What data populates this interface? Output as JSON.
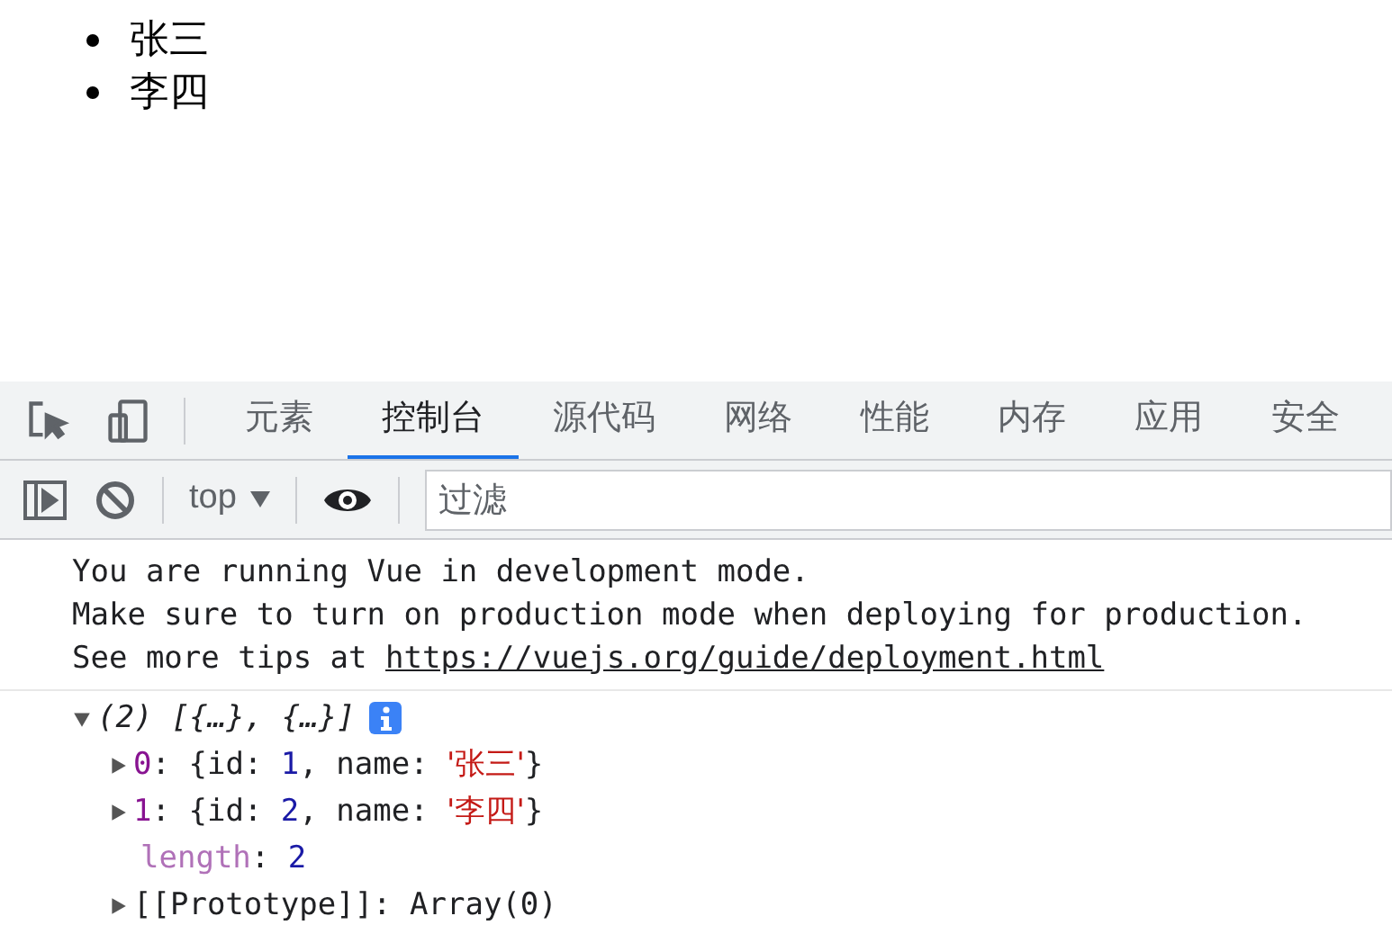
{
  "page_list": [
    "张三",
    "李四"
  ],
  "devtools": {
    "tabs": [
      {
        "label": "元素",
        "selected": false
      },
      {
        "label": "控制台",
        "selected": true
      },
      {
        "label": "源代码",
        "selected": false
      },
      {
        "label": "网络",
        "selected": false
      },
      {
        "label": "性能",
        "selected": false
      },
      {
        "label": "内存",
        "selected": false
      },
      {
        "label": "应用",
        "selected": false
      },
      {
        "label": "安全",
        "selected": false
      }
    ],
    "context": "top",
    "filter": {
      "placeholder": "过滤"
    }
  },
  "console": {
    "message_lines": [
      {
        "text": "You are running Vue in development mode."
      },
      {
        "text": "Make sure to turn on production mode when deploying for production."
      },
      {
        "text": "See more tips at ",
        "link": "https://vuejs.org/guide/deployment.html"
      }
    ],
    "log": {
      "expanded": true,
      "summary": "(2) [{…}, {…}]",
      "rows": [
        {
          "kind": "expandable",
          "expanded": false,
          "tokens": [
            {
              "kind": "index",
              "t": "0"
            },
            {
              "kind": "plain",
              "t": ": {id: "
            },
            {
              "kind": "number",
              "t": "1"
            },
            {
              "kind": "plain",
              "t": ", name: "
            },
            {
              "kind": "string",
              "t": "'张三'"
            },
            {
              "kind": "plain",
              "t": "}"
            }
          ]
        },
        {
          "kind": "expandable",
          "expanded": false,
          "tokens": [
            {
              "kind": "index",
              "t": "1"
            },
            {
              "kind": "plain",
              "t": ": {id: "
            },
            {
              "kind": "number",
              "t": "2"
            },
            {
              "kind": "plain",
              "t": ", name: "
            },
            {
              "kind": "string",
              "t": "'李四'"
            },
            {
              "kind": "plain",
              "t": "}"
            }
          ]
        },
        {
          "kind": "property",
          "tokens": [
            {
              "kind": "prop",
              "t": "length"
            },
            {
              "kind": "plain",
              "t": ": "
            },
            {
              "kind": "number",
              "t": "2"
            }
          ]
        },
        {
          "kind": "expandable",
          "expanded": false,
          "tokens": [
            {
              "kind": "plain",
              "t": "[[Prototype]]: Array(0)"
            }
          ]
        }
      ]
    }
  }
}
